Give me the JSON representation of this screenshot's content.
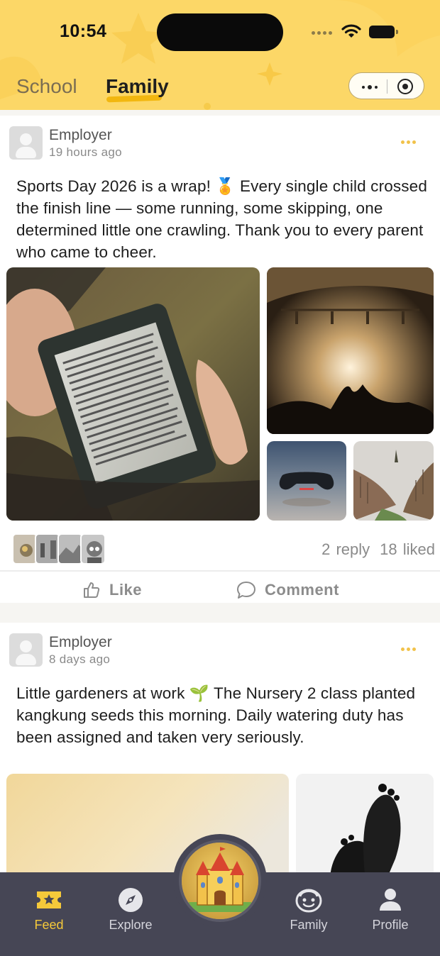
{
  "status_bar": {
    "time": "10:54"
  },
  "header": {
    "tabs": [
      {
        "label": "School",
        "active": false
      },
      {
        "label": "Family",
        "active": true
      }
    ],
    "capsule_icons": [
      "more-dots-icon",
      "target-circle-icon"
    ]
  },
  "posts": [
    {
      "author": "Employer",
      "time": "19 hours ago",
      "text": "Sports Day 2026 is a wrap! 🏅 Every single child crossed the finish line — some running, some skipping, one determined little one crawling. Thank you to every parent who came to cheer.",
      "replies": "2 reply",
      "likes": "18 liked",
      "like_label": "Like",
      "comment_label": "Comment"
    },
    {
      "author": "Employer",
      "time": "8 days ago",
      "text": "Little gardeners at work 🌱 The Nursery 2 class planted kangkung seeds this morning. Daily watering duty has been assigned and taken very seriously."
    }
  ],
  "tabbar": {
    "items": [
      {
        "label": "Feed",
        "icon": "ticket-star-icon",
        "active": true
      },
      {
        "label": "Explore",
        "icon": "compass-icon",
        "active": false
      },
      {
        "label": "Family",
        "icon": "smiley-face-icon",
        "active": false
      },
      {
        "label": "Profile",
        "icon": "person-icon",
        "active": false
      }
    ],
    "center_icon": "castle-icon"
  },
  "colors": {
    "header_bg": "#fcd767",
    "accent": "#f5c93a",
    "tabbar_bg": "#464655"
  }
}
